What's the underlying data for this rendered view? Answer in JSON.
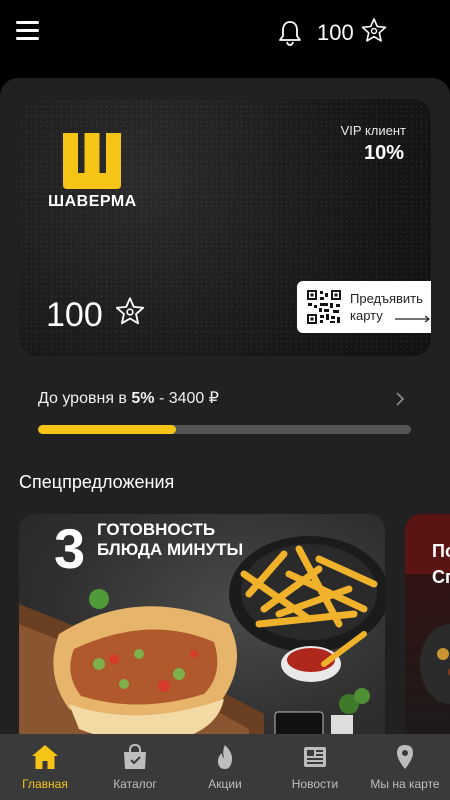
{
  "header": {
    "points": "100",
    "menu_icon": "hamburger-menu-icon",
    "notification_icon": "bell-icon",
    "points_icon": "star-badge-icon"
  },
  "card": {
    "brand_name": "ШАВЕРМА",
    "vip_label": "VIP клиент",
    "vip_percent": "10%",
    "points": "100",
    "qr_button_label": "Предъявить карту",
    "colors": {
      "brand_yellow": "#F6C417"
    }
  },
  "level": {
    "prefix": "До уровня в ",
    "percent": "5%",
    "suffix": " - 3400 ₽",
    "progress_fraction": 0.37
  },
  "offers": {
    "title": "Спецпредложения",
    "items": [
      {
        "number": "3",
        "title": "ГОТОВНОСТЬ БЛЮДА МИНУТЫ"
      },
      {
        "text": "По Сп"
      }
    ]
  },
  "nav": {
    "items": [
      {
        "label": "Главная",
        "icon": "home-icon",
        "active": true
      },
      {
        "label": "Каталог",
        "icon": "shopping-bag-icon",
        "active": false
      },
      {
        "label": "Акции",
        "icon": "flame-icon",
        "active": false
      },
      {
        "label": "Новости",
        "icon": "newspaper-icon",
        "active": false
      },
      {
        "label": "Мы на карте",
        "icon": "map-pin-icon",
        "active": false
      }
    ]
  }
}
